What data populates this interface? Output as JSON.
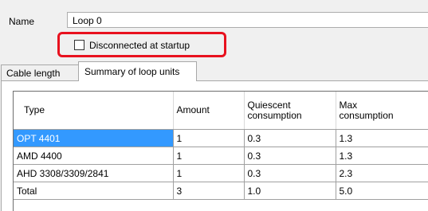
{
  "name_field": {
    "label": "Name",
    "value": "Loop 0"
  },
  "disconnected_checkbox": {
    "label": "Disconnected at startup",
    "checked": false,
    "highlight_color": "#e8111e"
  },
  "tabs": [
    {
      "label": "Cable length",
      "active": false
    },
    {
      "label": "Summary of loop units",
      "active": true
    }
  ],
  "grid": {
    "columns": [
      "Type",
      "Amount",
      "Quiescent\nconsumption",
      "Max\nconsumption"
    ],
    "rows": [
      {
        "type": "OPT 4401",
        "amount": "1",
        "quiescent": "0.3",
        "max": "1.3",
        "selected": true
      },
      {
        "type": "AMD 4400",
        "amount": "1",
        "quiescent": "0.3",
        "max": "1.3",
        "selected": false
      },
      {
        "type": "AHD 3308/3309/2841",
        "amount": "1",
        "quiescent": "0.3",
        "max": "2.3",
        "selected": false
      },
      {
        "type": "Total",
        "amount": "3",
        "quiescent": "1.0",
        "max": "5.0",
        "selected": false
      }
    ],
    "selection_color": "#3399ff"
  }
}
